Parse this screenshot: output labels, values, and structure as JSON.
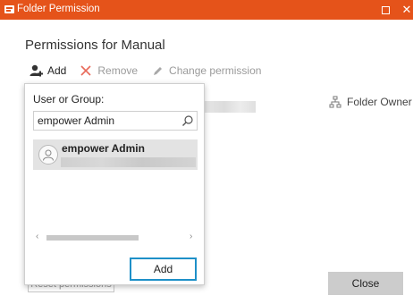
{
  "window": {
    "title": "Folder Permission",
    "accent_color": "#e5531a",
    "maximize_icon": "square-icon",
    "close_glyph": "✕"
  },
  "heading": "Permissions for Manual",
  "toolbar": {
    "add_label": "Add",
    "remove_label": "Remove",
    "change_label": "Change permission"
  },
  "owner": {
    "label": "Folder Owner",
    "icon": "hierarchy-icon"
  },
  "footer": {
    "reset_label": "Reset permissions",
    "close_label": "Close"
  },
  "popup": {
    "label": "User or Group:",
    "search_value": "empower Admin",
    "results": [
      {
        "name": "empower Admin",
        "selected": true
      }
    ],
    "scroll_left": "‹",
    "scroll_right": "›",
    "add_label": "Add",
    "focus_color": "#1e90c8"
  }
}
